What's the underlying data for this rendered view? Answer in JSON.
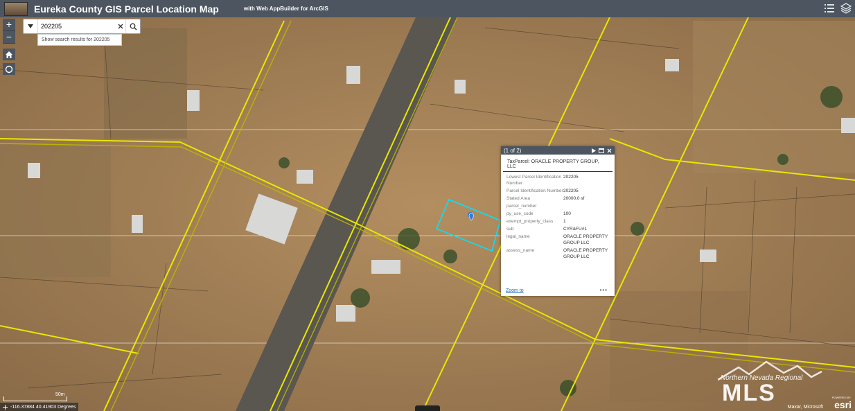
{
  "header": {
    "title": "Eureka County GIS Parcel Location Map",
    "subtitle": "with Web AppBuilder for ArcGIS",
    "list_icon": "list-icon",
    "layers_icon": "layers-icon"
  },
  "controls": {
    "zoom_in": "+",
    "zoom_out": "−",
    "home_icon": "home-icon",
    "locate_icon": "locate-icon"
  },
  "search": {
    "value": "202205",
    "suggestion": "Show search results for 202205"
  },
  "popup": {
    "counter": "(1 of 2)",
    "title": "TaxParcel: ORACLE PROPERTY GROUP, LLC",
    "rows": [
      {
        "key": "Lowest Parcel Identification Number",
        "value": "202205"
      },
      {
        "key": "Parcel Identification Number",
        "value": "202205"
      },
      {
        "key": "Stated Area",
        "value": "20000.0 sf"
      },
      {
        "key": "parcel_number",
        "value": ""
      },
      {
        "key": "py_use_code",
        "value": "100"
      },
      {
        "key": "exempt_property_class",
        "value": "1"
      },
      {
        "key": "sub",
        "value": "CYR&FU#1"
      },
      {
        "key": "legal_name",
        "value": "ORACLE PROPERTY GROUP LLC"
      },
      {
        "key": "assess_name",
        "value": "ORACLE PROPERTY GROUP LLC"
      }
    ],
    "zoom_link": "Zoom to",
    "more": "•••"
  },
  "statusbar": {
    "coordinates": "-116.37884 40.41903 Degrees",
    "scale": "50m",
    "attribution": "Maxar, Microsoft",
    "esri": "esri",
    "powered": "POWERED BY"
  },
  "watermark": {
    "line1": "Northern Nevada Regional",
    "line2": "MLS"
  },
  "colors": {
    "header": "#4c5560",
    "road": "#e8e800",
    "parcel_highlight": "#00e5ff"
  }
}
